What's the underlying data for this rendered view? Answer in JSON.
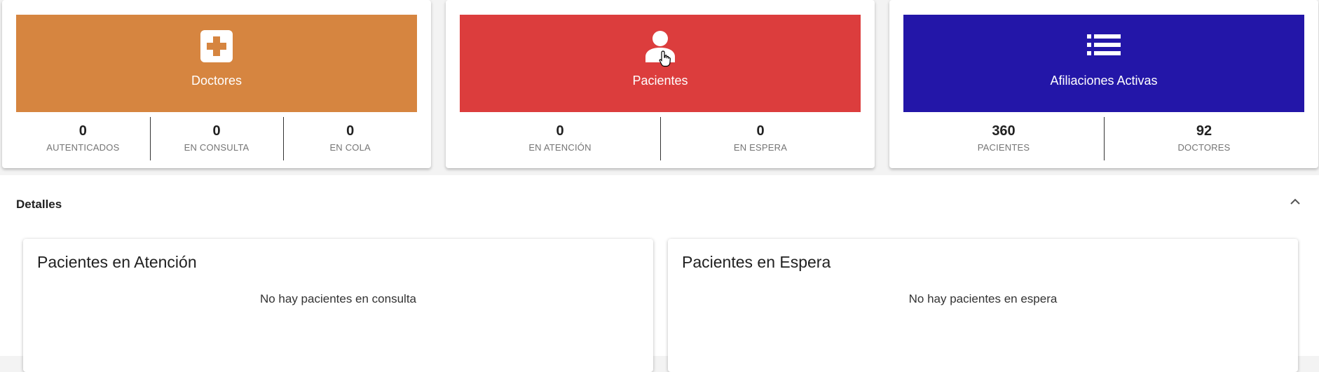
{
  "summary_cards": [
    {
      "title": "Doctores",
      "color": "#d68540",
      "icon": "medical-cross-icon",
      "stats": [
        {
          "value": "0",
          "label": "AUTENTICADOS"
        },
        {
          "value": "0",
          "label": "EN CONSULTA"
        },
        {
          "value": "0",
          "label": "EN COLA"
        }
      ]
    },
    {
      "title": "Pacientes",
      "color": "#dc3d3d",
      "icon": "person-icon",
      "stats": [
        {
          "value": "0",
          "label": "EN ATENCIÓN"
        },
        {
          "value": "0",
          "label": "EN ESPERA"
        }
      ]
    },
    {
      "title": "Afiliaciones Activas",
      "color": "#2316a8",
      "icon": "list-icon",
      "stats": [
        {
          "value": "360",
          "label": "PACIENTES"
        },
        {
          "value": "92",
          "label": "DOCTORES"
        }
      ]
    }
  ],
  "details": {
    "title": "Detalles",
    "collapse_icon": "chevron-up-icon",
    "panels": [
      {
        "title": "Pacientes en Atención",
        "empty_text": "No hay pacientes en consulta"
      },
      {
        "title": "Pacientes en Espera",
        "empty_text": "No hay pacientes en espera"
      }
    ]
  }
}
